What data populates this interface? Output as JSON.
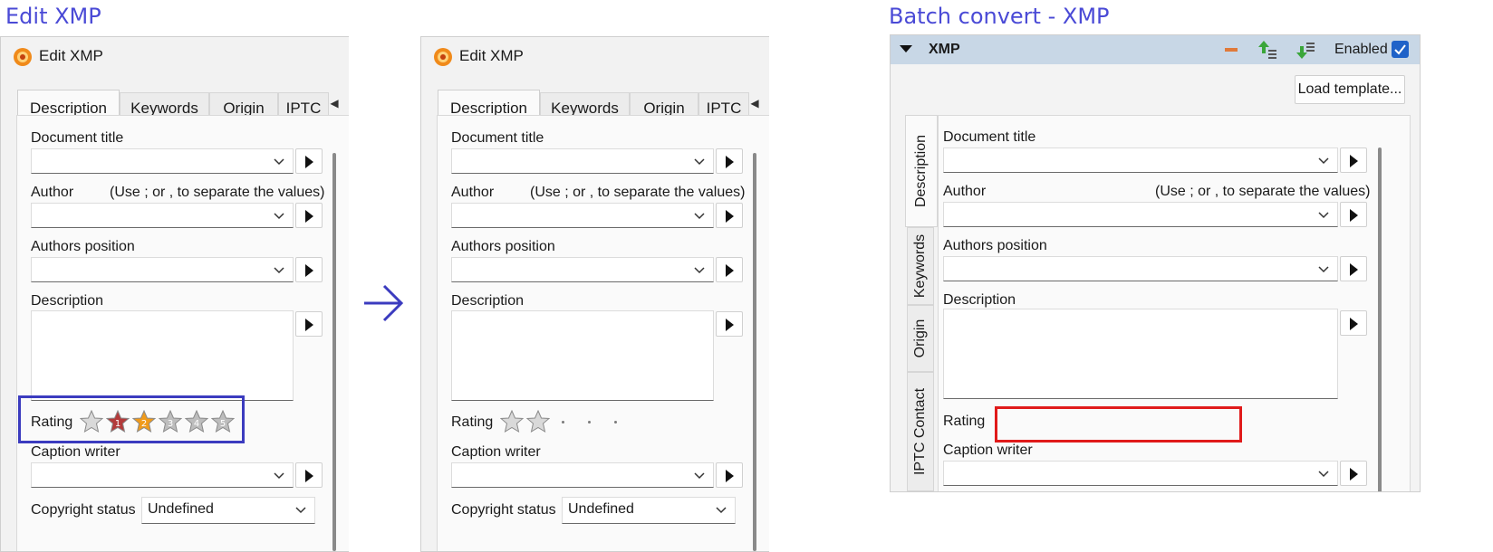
{
  "headings": {
    "left": "Edit XMP",
    "right": "Batch convert - XMP"
  },
  "dialog": {
    "title": "Edit XMP",
    "tabs": [
      "Description",
      "Keywords",
      "Origin",
      "IPTC"
    ],
    "tab_nav": {
      "prev": "◀",
      "next": "▶"
    },
    "fields": {
      "document_title": "Document title",
      "author": "Author",
      "author_hint": "(Use ; or , to separate the values)",
      "authors_position": "Authors position",
      "description": "Description",
      "rating": "Rating",
      "caption_writer": "Caption writer",
      "copyright_status": "Copyright status",
      "copyright_value": "Undefined"
    }
  },
  "before_rating": {
    "star_labels": [
      "",
      "1",
      "2",
      "3",
      "4",
      "5"
    ],
    "star_colors": [
      "#d9d9d9",
      "#b33a3a",
      "#f09a1a",
      "#bdbdbd",
      "#bdbdbd",
      "#bdbdbd"
    ]
  },
  "after_rating": {
    "filled_stars": 2,
    "empty_dots": 3
  },
  "batch": {
    "section": "XMP",
    "enabled_label": "Enabled",
    "enabled": true,
    "load_template": "Load template...",
    "vertical_tabs": [
      "Description",
      "Keywords",
      "Origin",
      "IPTC Contact"
    ],
    "fields": {
      "document_title": "Document title",
      "author": "Author",
      "author_hint": "(Use ; or , to separate the values)",
      "authors_position": "Authors position",
      "description": "Description",
      "rating": "Rating",
      "caption_writer": "Caption writer"
    }
  },
  "colors": {
    "highlight_blue": "#3b3bbf",
    "highlight_red": "#e01a1a",
    "heading": "#4a4ad6"
  }
}
